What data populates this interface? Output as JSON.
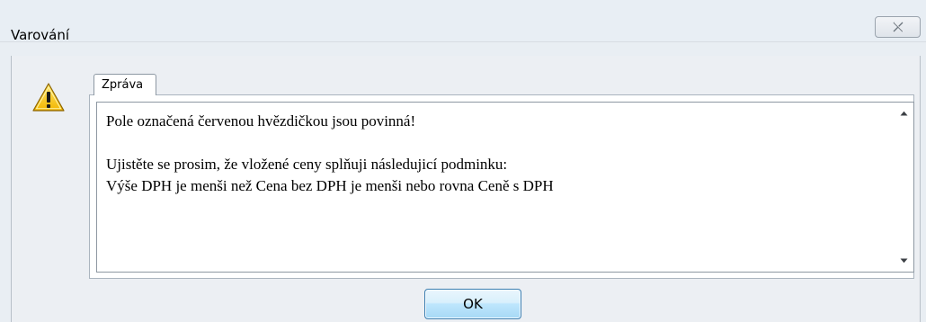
{
  "dialog": {
    "title": "Varování",
    "close_icon": "close-x-icon"
  },
  "tab": {
    "label": "Zpráva"
  },
  "message": {
    "lines": [
      "Pole označená červenou hvězdičkou jsou povinná!",
      "",
      "Ujistěte se prosim, že vložené ceny splňuji následujicí podminku:",
      "Výše DPH je menši než Cena bez DPH je menši nebo rovna Ceně s DPH"
    ]
  },
  "buttons": {
    "ok_label": "OK"
  },
  "icons": {
    "warning": "warning-triangle-icon",
    "scroll_up": "scroll-up-arrow-icon",
    "scroll_down": "scroll-down-arrow-icon"
  },
  "colors": {
    "warning_yellow": "#f6c21b",
    "warning_border": "#8c6400",
    "ok_button_border": "#3c7fb1"
  }
}
